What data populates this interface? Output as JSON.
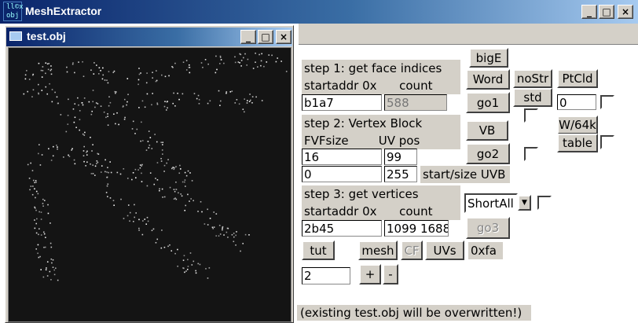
{
  "app": {
    "title": "MeshExtractor",
    "icon_text": "ll©x\nobj",
    "controls": {
      "minimize": "_",
      "maximize": "□",
      "close": "×"
    }
  },
  "child_window": {
    "title": "test.obj",
    "controls": {
      "minimize": "_",
      "maximize": "□",
      "close": "×"
    }
  },
  "step1": {
    "label": "step 1: get face indices",
    "sublabel": "startaddr 0x      count",
    "startaddr": "b1a7",
    "count": "588"
  },
  "step2": {
    "label": "step 2: Vertex Block",
    "sublabel": "FVFsize        UV pos",
    "fvfsize": "16",
    "uvpos": "99",
    "start": "0",
    "size": "255",
    "startsize_label": "start/size UVB"
  },
  "step3": {
    "label": "step 3: get vertices",
    "sublabel": "startaddr 0x      count",
    "startaddr": "2b45",
    "count": "1099 1688"
  },
  "buttons": {
    "bigE": "bigE",
    "word": "Word",
    "nostr": "noStr",
    "ptcld": "PtCld",
    "go1": "go1",
    "std": "std",
    "vb": "VB",
    "w64k": "W/64k",
    "table": "table",
    "go2": "go2",
    "go3": "go3",
    "tut": "tut",
    "mesh": "mesh",
    "cf": "CF",
    "uvs": "UVs",
    "plus": "+",
    "minus": "-"
  },
  "ptcld_value": "0",
  "select": {
    "value": "ShortAll",
    "arrow": "▼"
  },
  "hex_label": "0xfa",
  "tut_value": "2",
  "status_text": "(existing test.obj will be overwritten!)"
}
